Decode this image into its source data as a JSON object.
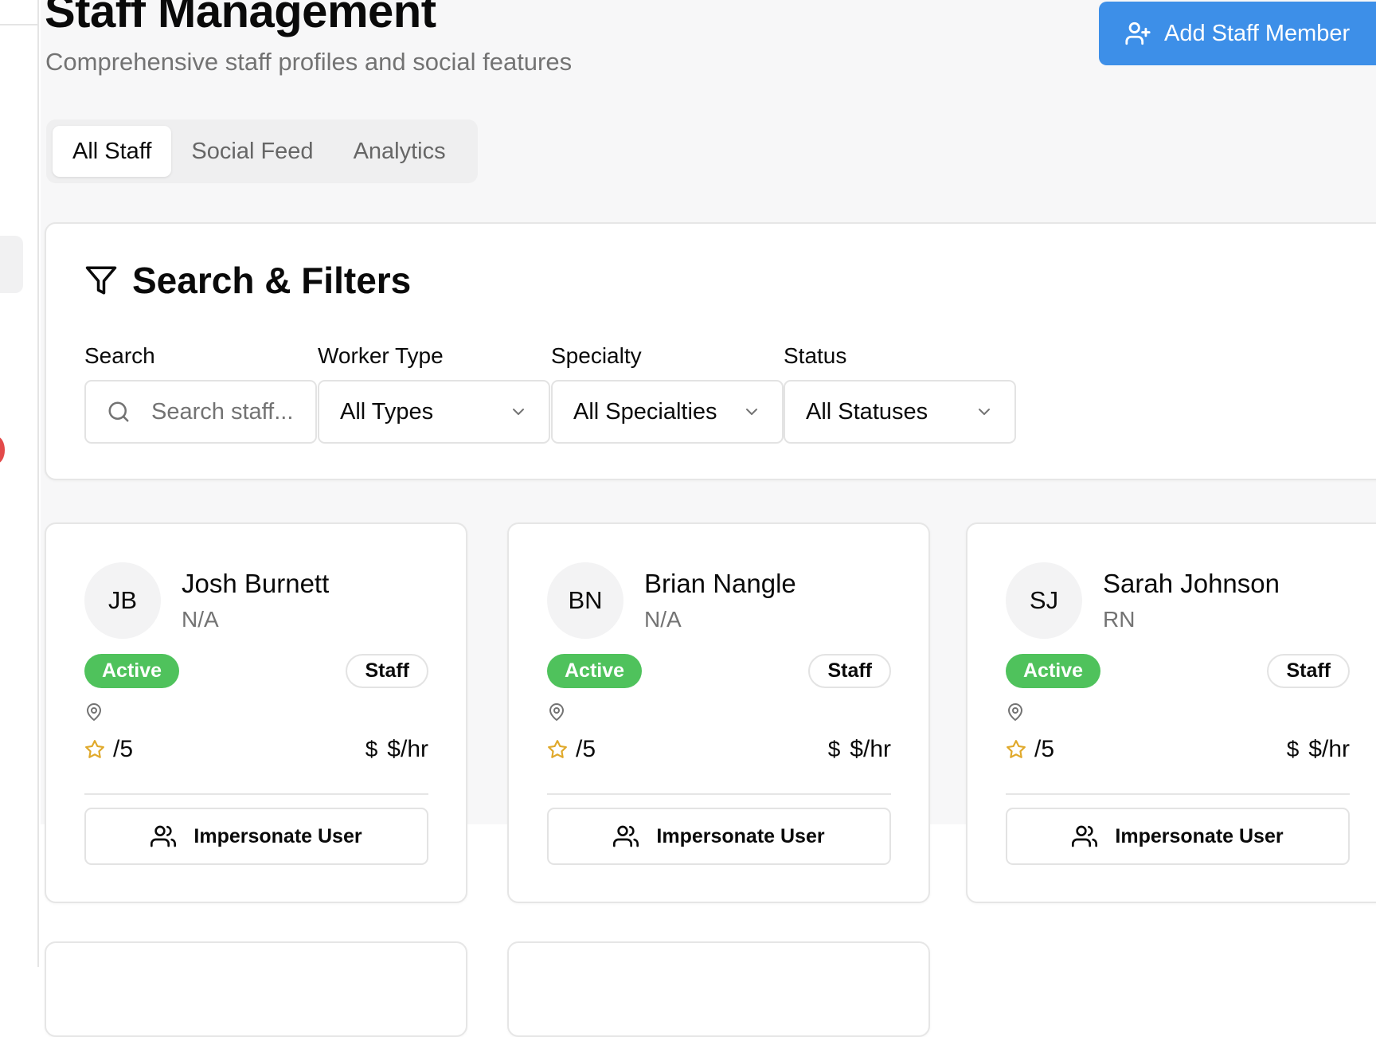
{
  "header": {
    "title": "Staff Management",
    "subtitle": "Comprehensive staff profiles and social features",
    "add_button_label": "Add Staff Member"
  },
  "tabs": [
    {
      "label": "All Staff",
      "active": true
    },
    {
      "label": "Social Feed",
      "active": false
    },
    {
      "label": "Analytics",
      "active": false
    }
  ],
  "filters": {
    "title": "Search & Filters",
    "search": {
      "label": "Search",
      "placeholder": "Search staff...",
      "value": ""
    },
    "worker_type": {
      "label": "Worker Type",
      "value": "All Types"
    },
    "specialty": {
      "label": "Specialty",
      "value": "All Specialties"
    },
    "status": {
      "label": "Status",
      "value": "All Statuses"
    }
  },
  "staff": [
    {
      "initials": "JB",
      "name": "Josh Burnett",
      "role": "N/A",
      "status": "Active",
      "type": "Staff",
      "rating": "/5",
      "rate_symbol": "$",
      "rate": "$/hr",
      "action": "Impersonate User"
    },
    {
      "initials": "BN",
      "name": "Brian Nangle",
      "role": "N/A",
      "status": "Active",
      "type": "Staff",
      "rating": "/5",
      "rate_symbol": "$",
      "rate": "$/hr",
      "action": "Impersonate User"
    },
    {
      "initials": "SJ",
      "name": "Sarah Johnson",
      "role": "RN",
      "status": "Active",
      "type": "Staff",
      "rating": "/5",
      "rate_symbol": "$",
      "rate": "$/hr",
      "action": "Impersonate User"
    }
  ],
  "colors": {
    "primary": "#3d8fe8",
    "active_badge": "#4fc25c",
    "star": "#e0a92b",
    "notification": "#e34a4a"
  },
  "icons": {
    "add_button": "user-plus-icon",
    "filter": "funnel-icon",
    "search": "search-icon",
    "dropdown": "chevron-down-icon",
    "location": "map-pin-icon",
    "rating": "star-icon",
    "impersonate": "users-icon"
  }
}
